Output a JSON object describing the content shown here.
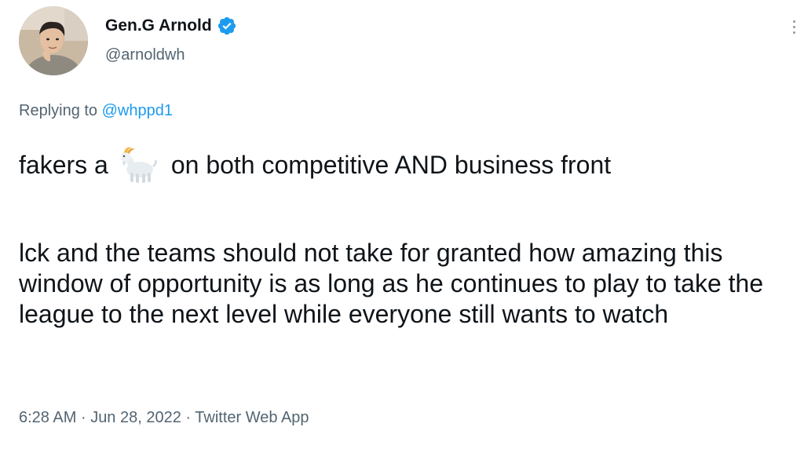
{
  "author": {
    "display_name": "Gen.G Arnold",
    "handle": "@arnoldwh",
    "verified": true,
    "avatar_icon": "profile-photo",
    "verified_icon": "verified-badge-icon",
    "verified_color": "#1d9bf0"
  },
  "reply": {
    "prefix": "Replying to",
    "mention": "@whppd1"
  },
  "tweet": {
    "line1_before": "fakers a",
    "emoji": "goat-emoji",
    "line1_after": "on both competitive AND business front",
    "paragraph2": "lck and the teams should not take for granted how amazing this window of opportunity is as long as he continues to play to take the league to the next level while everyone still wants to watch"
  },
  "meta": {
    "time": "6:28 AM",
    "date": "Jun 28, 2022",
    "source": "Twitter Web App",
    "separator": "·"
  },
  "colors": {
    "text": "#0f1419",
    "secondary": "#536471",
    "link": "#1d9bf0",
    "background": "#ffffff"
  }
}
